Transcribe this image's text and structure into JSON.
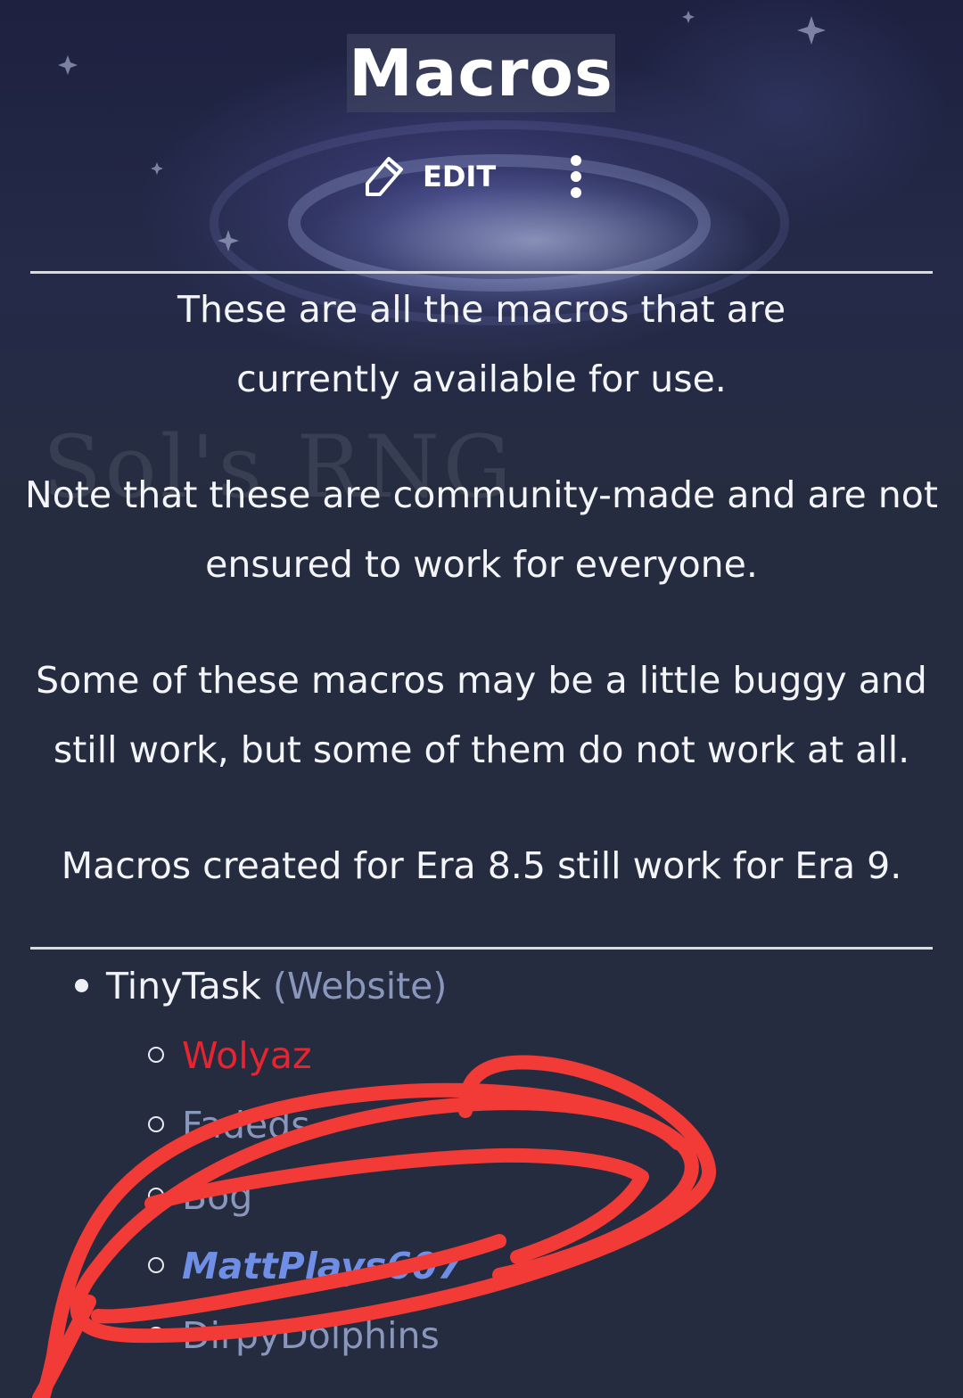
{
  "header": {
    "title": "Macros",
    "edit_label": "EDIT",
    "icons": {
      "edit": "pencil-icon",
      "more": "more-vertical-icon"
    },
    "watermark": "Sol's RNG"
  },
  "content": {
    "paragraphs": [
      "These are all the macros that are currently available for use.",
      "Note that these are community-made and are not ensured to work for everyone.",
      "Some of these macros may be a little buggy and still work, but some of them do not work at all.",
      "Macros created for Era 8.5 still work for Era 9."
    ]
  },
  "list": {
    "item": "TinyTask",
    "item_link": "(Website)",
    "sub_items": [
      "Wolyaz",
      "Fadeds",
      "Bog",
      "MattPlays607",
      "DirpyDolphins"
    ]
  },
  "colors": {
    "background": "#262c40",
    "link": "#8a97bd",
    "red_link": "#e8242f",
    "bold_link": "#6f8fe6",
    "annotation": "#f23a36"
  }
}
